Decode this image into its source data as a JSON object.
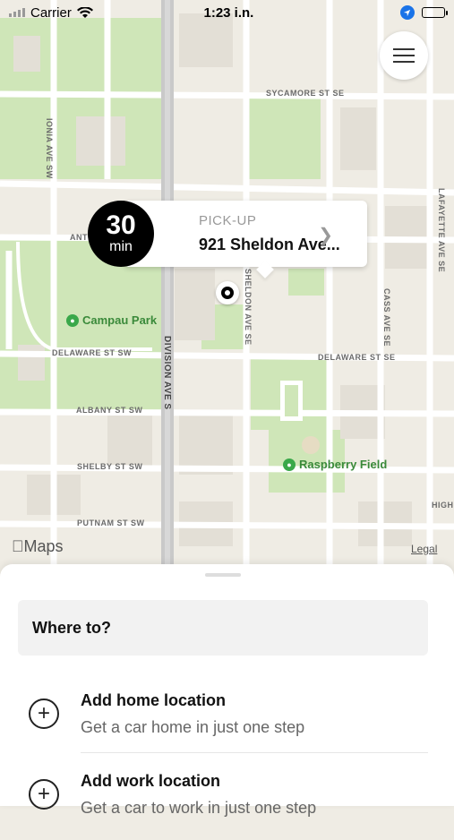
{
  "status_bar": {
    "carrier": "Carrier",
    "time": "1:23 i.n."
  },
  "map": {
    "streets": {
      "sycamore": "SYCAMORE ST SE",
      "ionia": "IONIA AVE SW",
      "lafayette": "LAFAYETTE AVE SE",
      "ant": "ANT",
      "sheldon": "SHELDON AVE SE",
      "cass": "CASS AVE SE",
      "delaware_sw": "DELAWARE ST SW",
      "delaware_se": "DELAWARE ST SE",
      "division": "DIVISION AVE S",
      "albany": "ALBANY ST SW",
      "shelby": "SHELBY ST SW",
      "putnam": "PUTNAM ST SW",
      "high": "HIGH"
    },
    "parks": {
      "campau": "Campau Park",
      "raspberry": "Raspberry Field"
    },
    "maps_logo": "Maps",
    "legal": "Legal"
  },
  "pickup": {
    "eta_value": "30",
    "eta_unit": "min",
    "label": "PICK-UP",
    "address": "921 Sheldon Ave..."
  },
  "sheet": {
    "search_placeholder": "Where to?",
    "items": [
      {
        "title": "Add home location",
        "subtitle": "Get a car home in just one step"
      },
      {
        "title": "Add work location",
        "subtitle": "Get a car to work in just one step"
      }
    ]
  }
}
